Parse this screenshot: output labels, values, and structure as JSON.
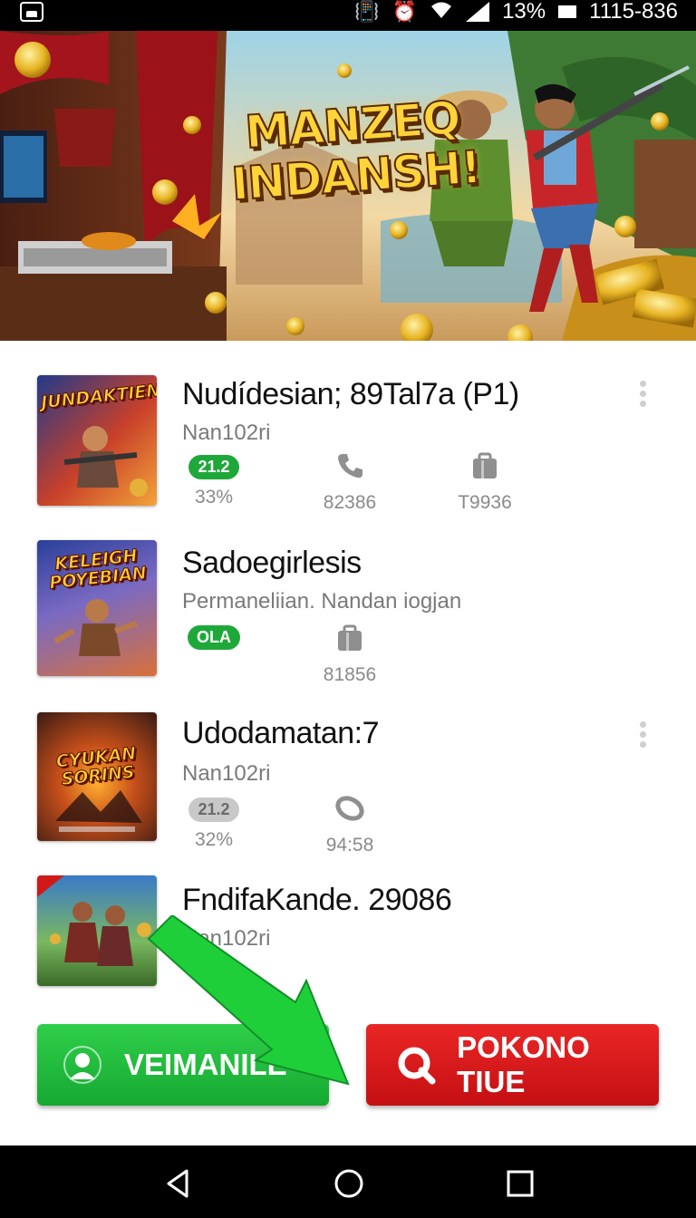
{
  "status_bar": {
    "battery": "13%",
    "time": "1115-836"
  },
  "hero": {
    "title_line1": "MANZEQ",
    "title_line2": "INDANSH!"
  },
  "games": [
    {
      "title": "Nudídesian; 89Tal7a (P1)",
      "subtitle": "Nan102ri",
      "thumb_text": "JUNDAKTIEN",
      "stats": [
        {
          "type": "badge",
          "badge": "21.2",
          "badge_color": "#1fa83a",
          "value": "33%"
        },
        {
          "type": "icon",
          "icon": "phone-icon",
          "value": "82386"
        },
        {
          "type": "icon",
          "icon": "bag-icon",
          "value": "T9936"
        }
      ]
    },
    {
      "title": "Sadoegirlesis",
      "subtitle": "Permaneliian. Nandan iogjan",
      "thumb_text": "KELEIGH POYEBIAN",
      "stats": [
        {
          "type": "badge",
          "badge": "OLA",
          "badge_color": "#1fa83a",
          "value": ""
        },
        {
          "type": "icon",
          "icon": "bag-icon",
          "value": "81856"
        }
      ]
    },
    {
      "title": "Udodamatan:7",
      "subtitle": "Nan102ri",
      "thumb_text": "CYUKAN SORINS",
      "stats": [
        {
          "type": "badge",
          "badge": "21.2",
          "badge_color": "#c8c8c8",
          "value": "32%"
        },
        {
          "type": "icon",
          "icon": "tag-icon",
          "value": "94:58"
        }
      ]
    },
    {
      "title": "FndifaKande. 29086",
      "subtitle": "Nan102ri",
      "thumb_text": "",
      "stats": []
    }
  ],
  "buttons": {
    "left_label": "VEIMANILE",
    "right_label": "POKONO TIUE"
  },
  "colors": {
    "green": "#1fa83a",
    "red": "#d41a1c"
  }
}
